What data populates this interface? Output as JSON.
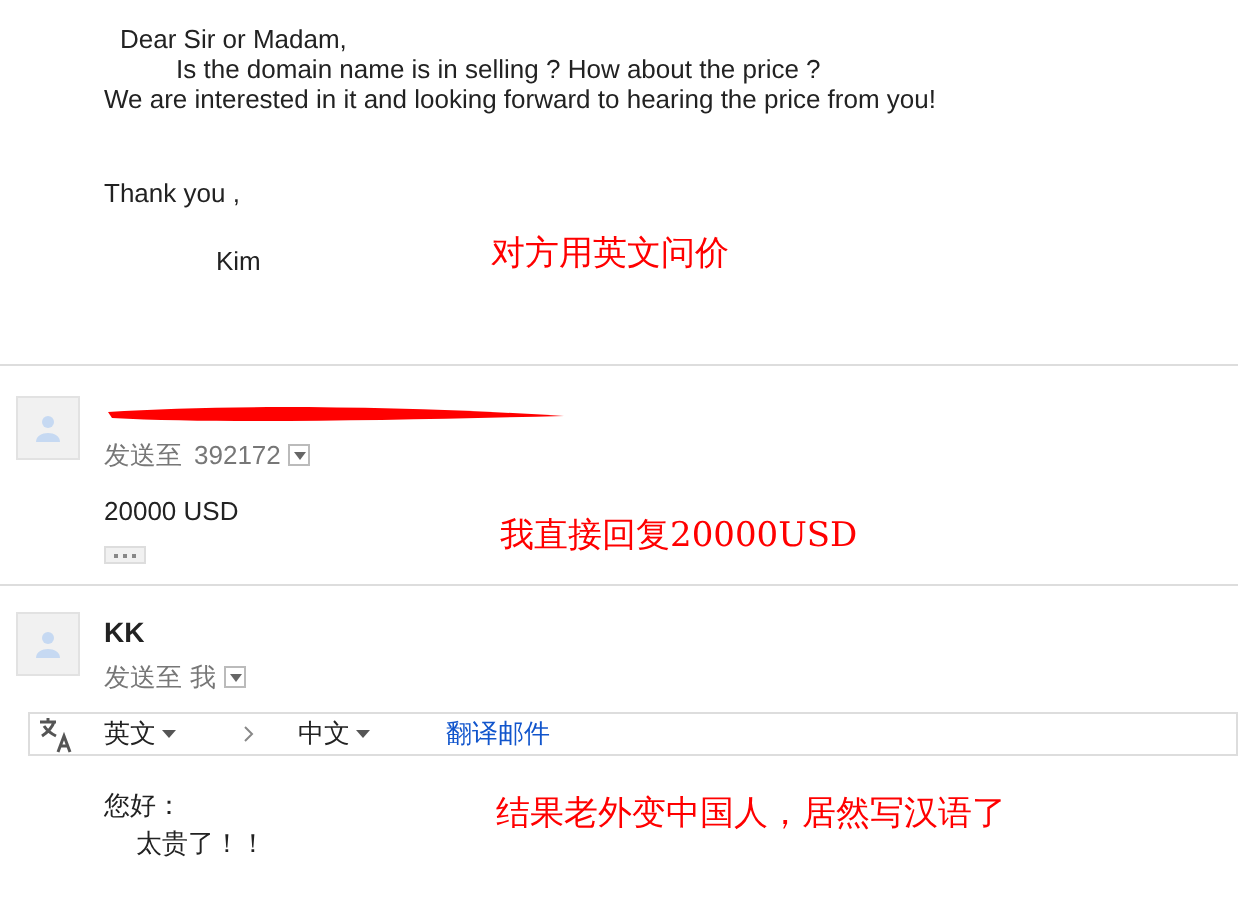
{
  "first_message": {
    "greeting": "Dear Sir or Madam,",
    "question": "Is the domain name is in selling ? How about the price ?",
    "interest": "We are interested in it and looking forward to hearing the price from you!",
    "thanks": "Thank you ,",
    "signature": "Kim",
    "annotation": "对方用英文问价"
  },
  "reply": {
    "sender_redacted": true,
    "recipient_label": "发送至",
    "recipient": "392172",
    "body": "20000 USD",
    "annotation": "我直接回复20000USD"
  },
  "last_message": {
    "sender": "KK",
    "recipient_label": "发送至",
    "recipient": "我",
    "translate_bar": {
      "source": "英文",
      "target": "中文",
      "action": "翻译邮件"
    },
    "body": [
      "您好：",
      "太贵了！！"
    ],
    "annotation": "结果老外变中国人，居然写汉语了"
  }
}
